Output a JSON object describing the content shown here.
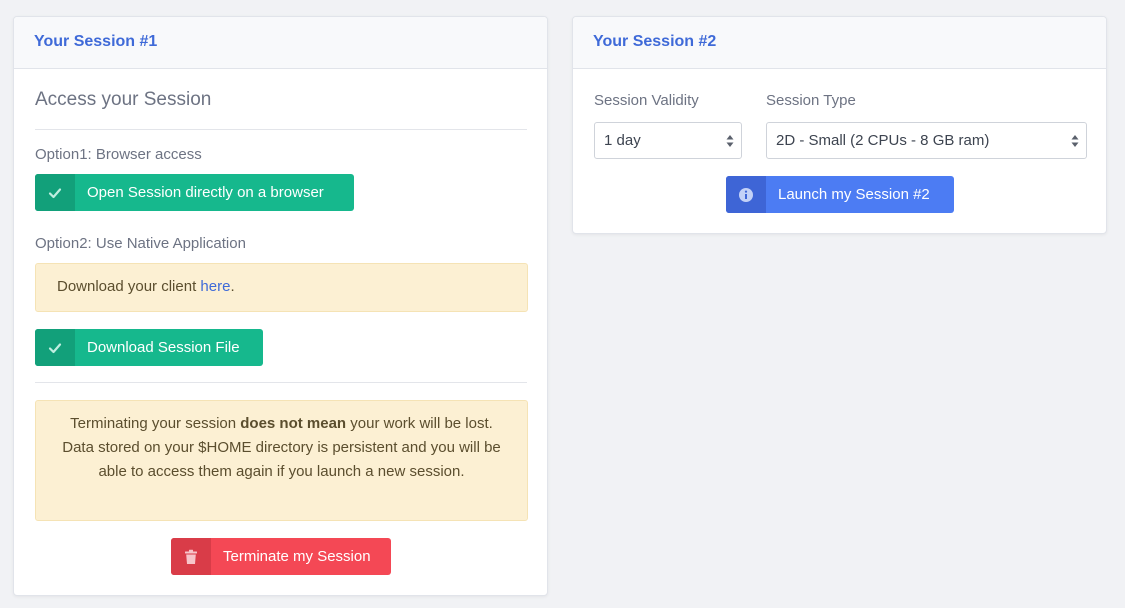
{
  "session1": {
    "title": "Your Session #1",
    "section_title": "Access your Session",
    "option1_label": "Option1: Browser access",
    "open_browser_button": "Open Session directly on a browser",
    "option2_label": "Option2: Use Native Application",
    "download_client_text": "Download your client ",
    "download_client_link": "here",
    "download_client_period": ".",
    "download_file_button": "Download Session File",
    "warning": {
      "part1": "Terminating your session ",
      "bold": "does not mean",
      "part2": " your work will be lost.",
      "line2": "Data stored on your $HOME directory is persistent and you will be able to access them again if you launch a new session."
    },
    "terminate_button": "Terminate my Session"
  },
  "session2": {
    "title": "Your Session #2",
    "validity_label": "Session Validity",
    "validity_value": "1 day",
    "type_label": "Session Type",
    "type_value": "2D - Small (2 CPUs - 8 GB ram)",
    "launch_button": "Launch my Session #2"
  },
  "icons": {
    "check": "check-icon",
    "trash": "trash-icon",
    "info": "info-icon",
    "select_arrows": "select-arrows-icon"
  },
  "colors": {
    "accent": "#3f6ad8",
    "success": "#16b88d",
    "danger": "#f44855",
    "primary": "#4c7cf3",
    "warning_bg": "#fcf0d3"
  }
}
